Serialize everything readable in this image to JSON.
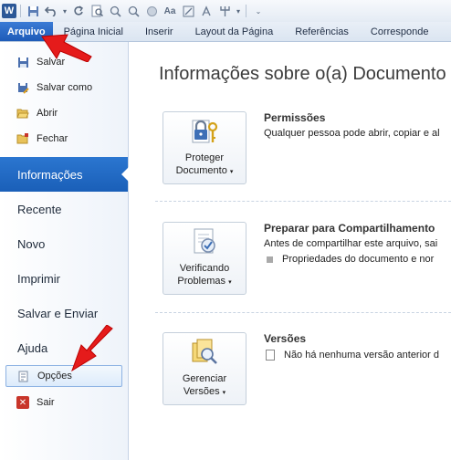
{
  "app": {
    "icon_letter": "W"
  },
  "quick_access": {
    "icons": [
      "save-icon",
      "undo-icon",
      "redo-icon",
      "print-preview-icon",
      "zoom-in-icon",
      "zoom-out-icon",
      "record-icon",
      "font-icon",
      "format-painter-icon",
      "text-direction-icon",
      "customize-icon"
    ]
  },
  "ribbon": {
    "tabs": [
      {
        "label": "Arquivo"
      },
      {
        "label": "Página Inicial"
      },
      {
        "label": "Inserir"
      },
      {
        "label": "Layout da Página"
      },
      {
        "label": "Referências"
      },
      {
        "label": "Corresponde"
      }
    ]
  },
  "backstage_nav": {
    "small_items": [
      {
        "label": "Salvar",
        "icon": "save-icon"
      },
      {
        "label": "Salvar como",
        "icon": "save-as-icon"
      },
      {
        "label": "Abrir",
        "icon": "open-folder-icon"
      },
      {
        "label": "Fechar",
        "icon": "close-folder-icon"
      }
    ],
    "active_item": "Informações",
    "big_items": [
      "Recente",
      "Novo",
      "Imprimir",
      "Salvar e Enviar",
      "Ajuda"
    ],
    "options_label": "Opções",
    "exit_label": "Sair"
  },
  "main": {
    "title": "Informações sobre o(a) Documento",
    "sections": [
      {
        "button_line1": "Proteger",
        "button_line2": "Documento",
        "heading": "Permissões",
        "description": "Qualquer pessoa pode abrir, copiar e al"
      },
      {
        "button_line1": "Verificando",
        "button_line2": "Problemas",
        "heading": "Preparar para Compartilhamento",
        "description": "Antes de compartilhar este arquivo, sai",
        "bullet": "Propriedades do documento e nor"
      },
      {
        "button_line1": "Gerenciar",
        "button_line2": "Versões",
        "heading": "Versões",
        "bullet": "Não há nenhuma versão anterior d"
      }
    ]
  },
  "colors": {
    "accent": "#1e5bb8",
    "arrow": "#e51b1b"
  }
}
